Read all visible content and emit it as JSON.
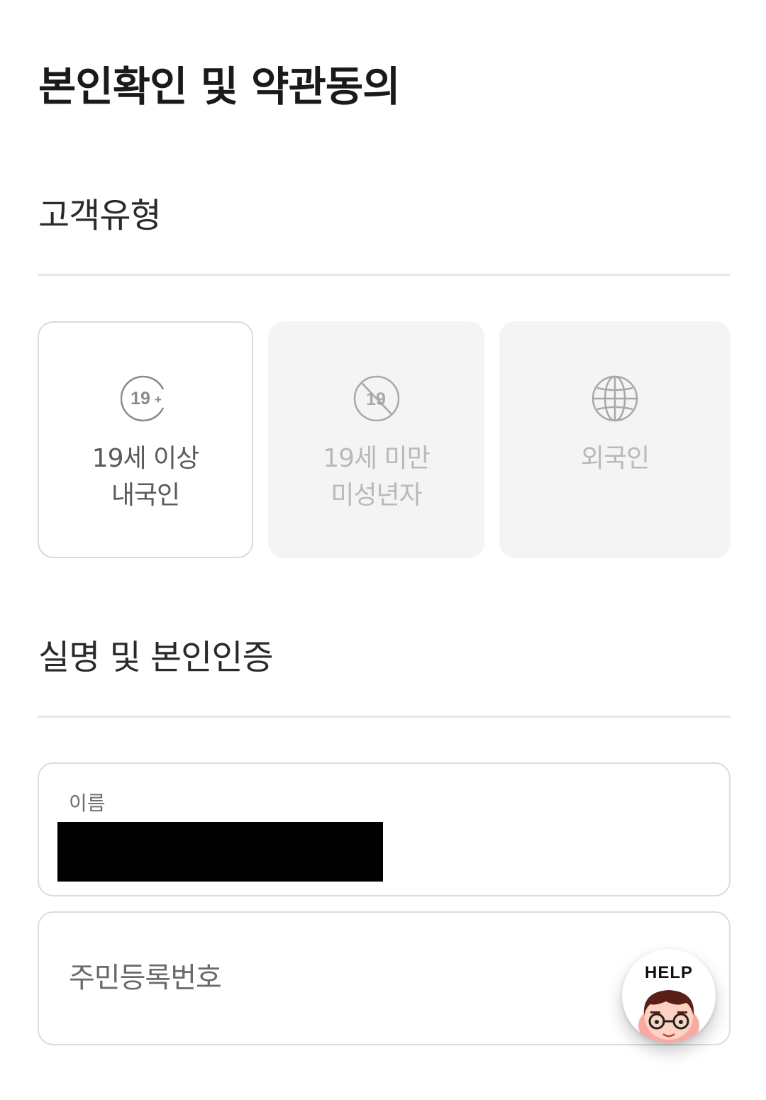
{
  "page": {
    "title": "본인확인 및 약관동의"
  },
  "customer_type": {
    "section_title": "고객유형",
    "options": [
      {
        "line1": "19세 이상",
        "line2": "내국인",
        "icon": "adult-19-plus-icon",
        "state": "selected"
      },
      {
        "line1": "19세 미만",
        "line2": "미성년자",
        "icon": "no-19-icon",
        "state": "disabled"
      },
      {
        "line1": "외국인",
        "line2": "",
        "icon": "globe-icon",
        "state": "disabled"
      }
    ],
    "icon_text": {
      "adult": "19",
      "adult_plus": "+",
      "minor": "19"
    }
  },
  "verification": {
    "section_title": "실명 및 본인인증",
    "name_field": {
      "label": "이름"
    },
    "rrn_field": {
      "placeholder": "주민등록번호"
    }
  },
  "help_button": {
    "label": "HELP",
    "icon": "help-mascot-icon"
  },
  "colors": {
    "selected_border": "#dadada",
    "disabled_background": "#f4f4f4",
    "divider": "#e7e7e7"
  }
}
